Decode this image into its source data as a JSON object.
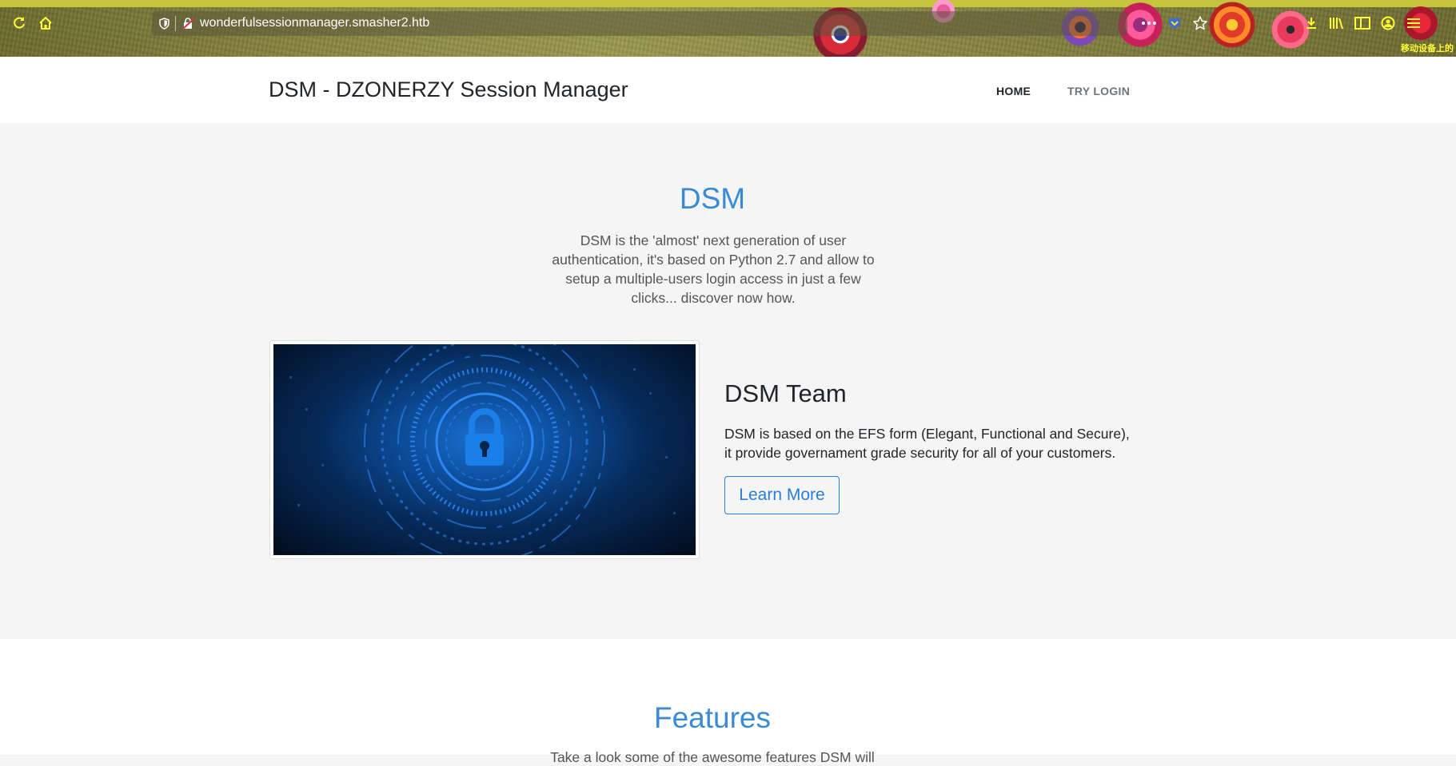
{
  "browser": {
    "url": "wonderfulsessionmanager.smasher2.htb",
    "mobile_note": "移动设备上的"
  },
  "navbar": {
    "brand": "DSM - DZONERZY Session Manager",
    "links": [
      {
        "label": "HOME",
        "active": true
      },
      {
        "label": "TRY LOGIN",
        "active": false
      }
    ]
  },
  "hero": {
    "title": "DSM",
    "description": "DSM is the 'almost' next generation of user authentication, it's based on Python 2.7 and allow to setup a multiple-users login access in just a few clicks... discover now how."
  },
  "team": {
    "title": "DSM Team",
    "description": "DSM is based on the EFS form (Elegant, Functional and Secure), it provide governament grade security for all of your customers.",
    "button_label": "Learn More"
  },
  "features": {
    "title": "Features",
    "subtitle": "Take a look some of the awesome features DSM will"
  },
  "colors": {
    "accent": "#3a8bd6",
    "button": "#2a7ed6",
    "toolbar_icon": "#ffff33"
  }
}
